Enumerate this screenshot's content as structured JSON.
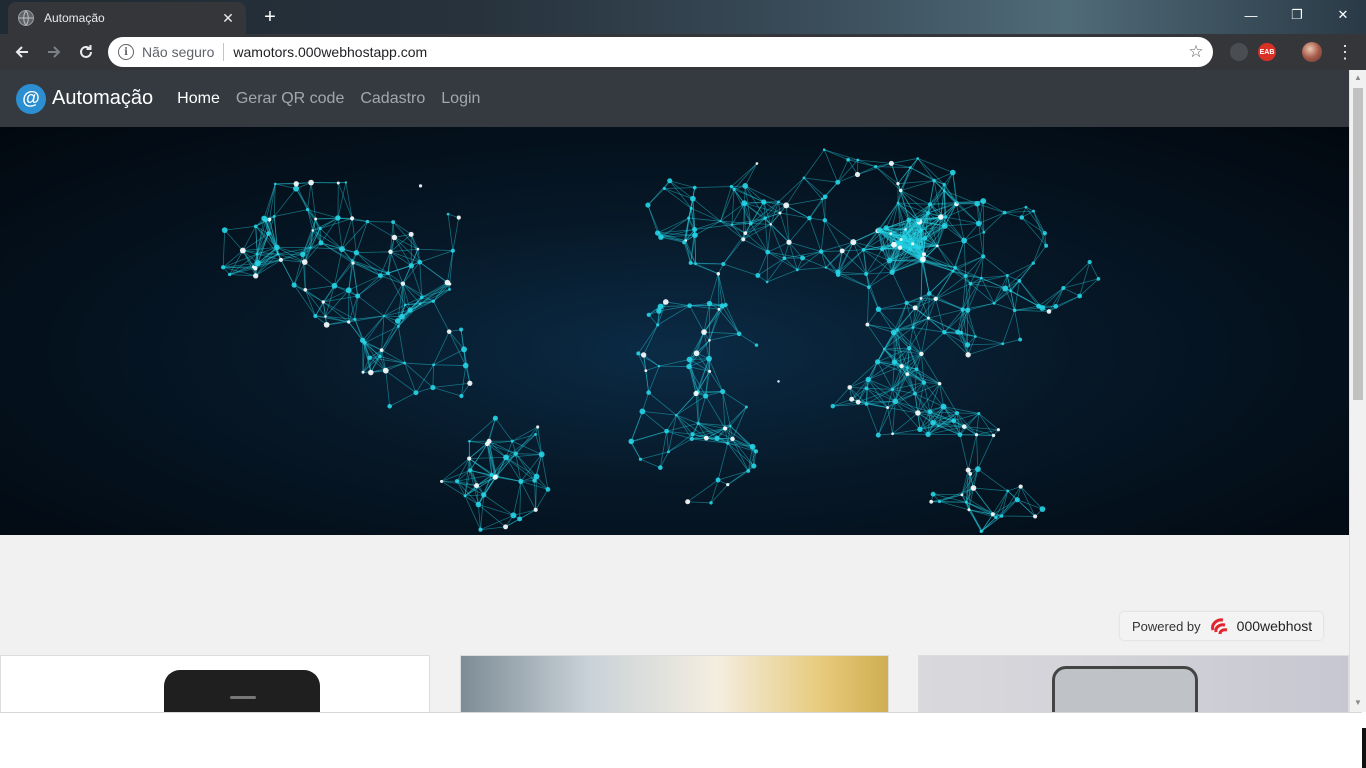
{
  "browser": {
    "tab_title": "Automação",
    "new_tab_glyph": "+",
    "close_tab_glyph": "✕",
    "security_label": "Não seguro",
    "url": "wamotors.000webhostapp.com",
    "bookmark_star": "☆",
    "extension_badge": "EAB",
    "window_controls": [
      "—",
      "❐",
      "✕"
    ]
  },
  "site": {
    "brand_name": "Automação",
    "brand_logo_char": "@",
    "nav": [
      {
        "label": "Home",
        "active": true
      },
      {
        "label": "Gerar QR code",
        "active": false
      },
      {
        "label": "Cadastro",
        "active": false
      },
      {
        "label": "Login",
        "active": false
      }
    ],
    "hero_image": "world-network-map"
  },
  "footer_badge": {
    "label": "Powered by",
    "host": "000webhost"
  },
  "colors": {
    "navbar": "#343a40",
    "accent_cyan": "#26d4e6",
    "brand_logo": "#2c8fd1",
    "page_bg": "#f1f1f1"
  }
}
